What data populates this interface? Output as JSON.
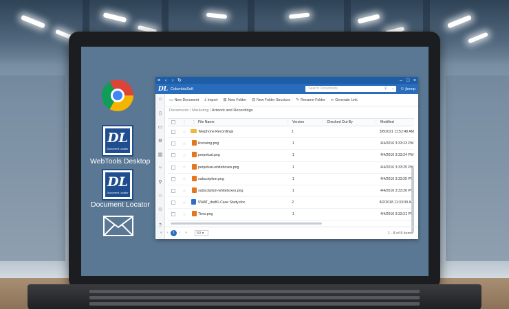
{
  "desktop": {
    "icons": [
      {
        "label": ""
      },
      {
        "label": "WebTools Desktop",
        "logo_text": "DL",
        "logo_sub": "Document Locator"
      },
      {
        "label": "Document Locator",
        "logo_text": "DL",
        "logo_sub": "Document Locator"
      },
      {
        "label": ""
      }
    ]
  },
  "app": {
    "titlebar": {
      "menu": "≡",
      "back": "‹",
      "forward": "›",
      "refresh": "↻",
      "minimize": "–",
      "maximize": "□",
      "close": "×"
    },
    "header": {
      "logo": "DL",
      "brand": "ColumbiaSoft",
      "search_placeholder": "Search Documents",
      "user": "jkemp"
    },
    "toolbar": [
      {
        "label": "New Document"
      },
      {
        "label": "Import"
      },
      {
        "label": "New Folder"
      },
      {
        "label": "New Folder Structure"
      },
      {
        "label": "Rename Folder"
      },
      {
        "label": "Generate Link"
      }
    ],
    "breadcrumb": {
      "items": [
        "Documents",
        "Marketing"
      ],
      "current": "Artwork and Recordings",
      "separator": "/"
    },
    "grid": {
      "columns": {
        "name": "File Name",
        "version": "Version",
        "checked_out": "Checked Out By",
        "modified": "Modified"
      },
      "rows": [
        {
          "type": "folder",
          "name": "Telephone Recordings",
          "version": "1",
          "checked_out": "",
          "modified": "3/8/2021 11:52:48 AM"
        },
        {
          "type": "png",
          "name": "licensing.png",
          "version": "1",
          "checked_out": "",
          "modified": "4/4/2016 3:33:23 PM"
        },
        {
          "type": "png",
          "name": "perpetual.png",
          "version": "1",
          "checked_out": "",
          "modified": "4/4/2016 3:33:24 PM"
        },
        {
          "type": "png",
          "name": "perpetual-whiteboxes.png",
          "version": "1",
          "checked_out": "",
          "modified": "4/4/2016 3:33:25 PM"
        },
        {
          "type": "png",
          "name": "subscription.png",
          "version": "1",
          "checked_out": "",
          "modified": "4/4/2016 3:33:25 PM"
        },
        {
          "type": "png",
          "name": "subscription-whiteboxes.png",
          "version": "1",
          "checked_out": "",
          "modified": "4/4/2016 3:33:26 PM"
        },
        {
          "type": "doc",
          "name": "SWAT_draft1-Case Study.doc",
          "version": "2",
          "checked_out": "",
          "modified": "8/2/2018 11:33:09 AM"
        },
        {
          "type": "png",
          "name": "Tiers.png",
          "version": "1",
          "checked_out": "",
          "modified": "4/4/2016 3:33:21 PM"
        }
      ]
    },
    "pager": {
      "first": "«",
      "prev": "‹",
      "page": "1",
      "next": "›",
      "last": "»",
      "page_size": "50",
      "count": "1 - 8 of 8 items"
    }
  }
}
